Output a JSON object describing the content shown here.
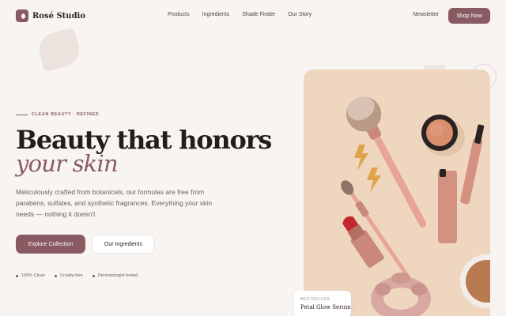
{
  "brand": {
    "name": "Rosé Studio",
    "accent": "#8a5a62"
  },
  "nav": {
    "links": [
      "Products",
      "Ingredients",
      "Shade Finder",
      "Our Story"
    ],
    "newsletter": "Newsletter",
    "cta": "Shop Now"
  },
  "hero": {
    "eyebrow": "CLEAN BEAUTY · REFINED",
    "title_line1": "Beauty that honors",
    "title_line2": "your skin",
    "description": "Meticulously crafted from botanicals, our formulas are free from parabens, sulfates, and synthetic fragrances. Everything your skin needs — nothing it doesn't.",
    "primary_button": "Explore Collection",
    "secondary_button": "Our Ingredients",
    "badges": [
      "100% Clean",
      "Cruelty-free",
      "Dermatologist tested"
    ]
  },
  "feature_card": {
    "label": "BESTSELLER",
    "product": "Petal Glow Serum",
    "image": "makeup-flatlay-illustration"
  }
}
